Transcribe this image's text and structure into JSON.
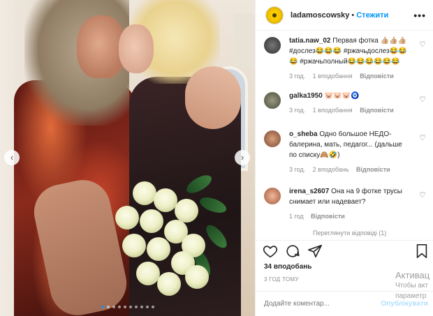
{
  "header": {
    "username": "ladamoscowsky",
    "separator": "•",
    "follow_label": "Стежити",
    "more_label": "•••"
  },
  "comments": [
    {
      "username": "tatia.naw_02",
      "text": "Первая фотка 👍🏼👍🏼👍🏼#дослез😂😂😂 #ржачьдослез😂😂😂 #ржачьполный😂😂😂😂😂😂",
      "time": "3 год.",
      "likes": "1 вподобання",
      "reply": "Відповісти",
      "avatar_color": "#3a3a3a"
    },
    {
      "username": "galka1950",
      "text": "🐷🐷🐷🧿",
      "time": "3 год.",
      "likes": "1 вподобання",
      "reply": "Відповісти",
      "avatar_color": "#6b6b5a"
    },
    {
      "username": "o_sheba",
      "text": "Одно большое НЕДО-балерина, мать, педагог... (дальше по списку🙈🤣)",
      "time": "3 год.",
      "likes": "2 вподобань",
      "reply": "Відповісти",
      "avatar_color": "#a86b4a"
    },
    {
      "username": "irena_s2607",
      "text": "Она на 9 фотке трусы снимает или надевает?",
      "time": "1 год",
      "likes": "",
      "reply": "Відповісти",
      "avatar_color": "#c9846a"
    }
  ],
  "more_replies_label": "Переглянути відповіді (1)",
  "likes_count": "34 вподобань",
  "post_time": "3 ГОД ТОМУ",
  "add_comment": {
    "placeholder": "Додайте коментар...",
    "post_label": "Опублікувати"
  },
  "watermark": {
    "line1": "Активац",
    "line2": "Чтобы акт",
    "line3": "параметр"
  },
  "carousel": {
    "slide_count": 10,
    "active_slide": 1
  },
  "colors": {
    "accent": "#0095f6",
    "post_button_disabled": "#b2dffc",
    "muted_text": "#8e8e8e"
  },
  "icons": [
    "heart-icon",
    "comment-icon",
    "share-icon",
    "bookmark-icon",
    "chevron-left-icon",
    "chevron-right-icon"
  ]
}
